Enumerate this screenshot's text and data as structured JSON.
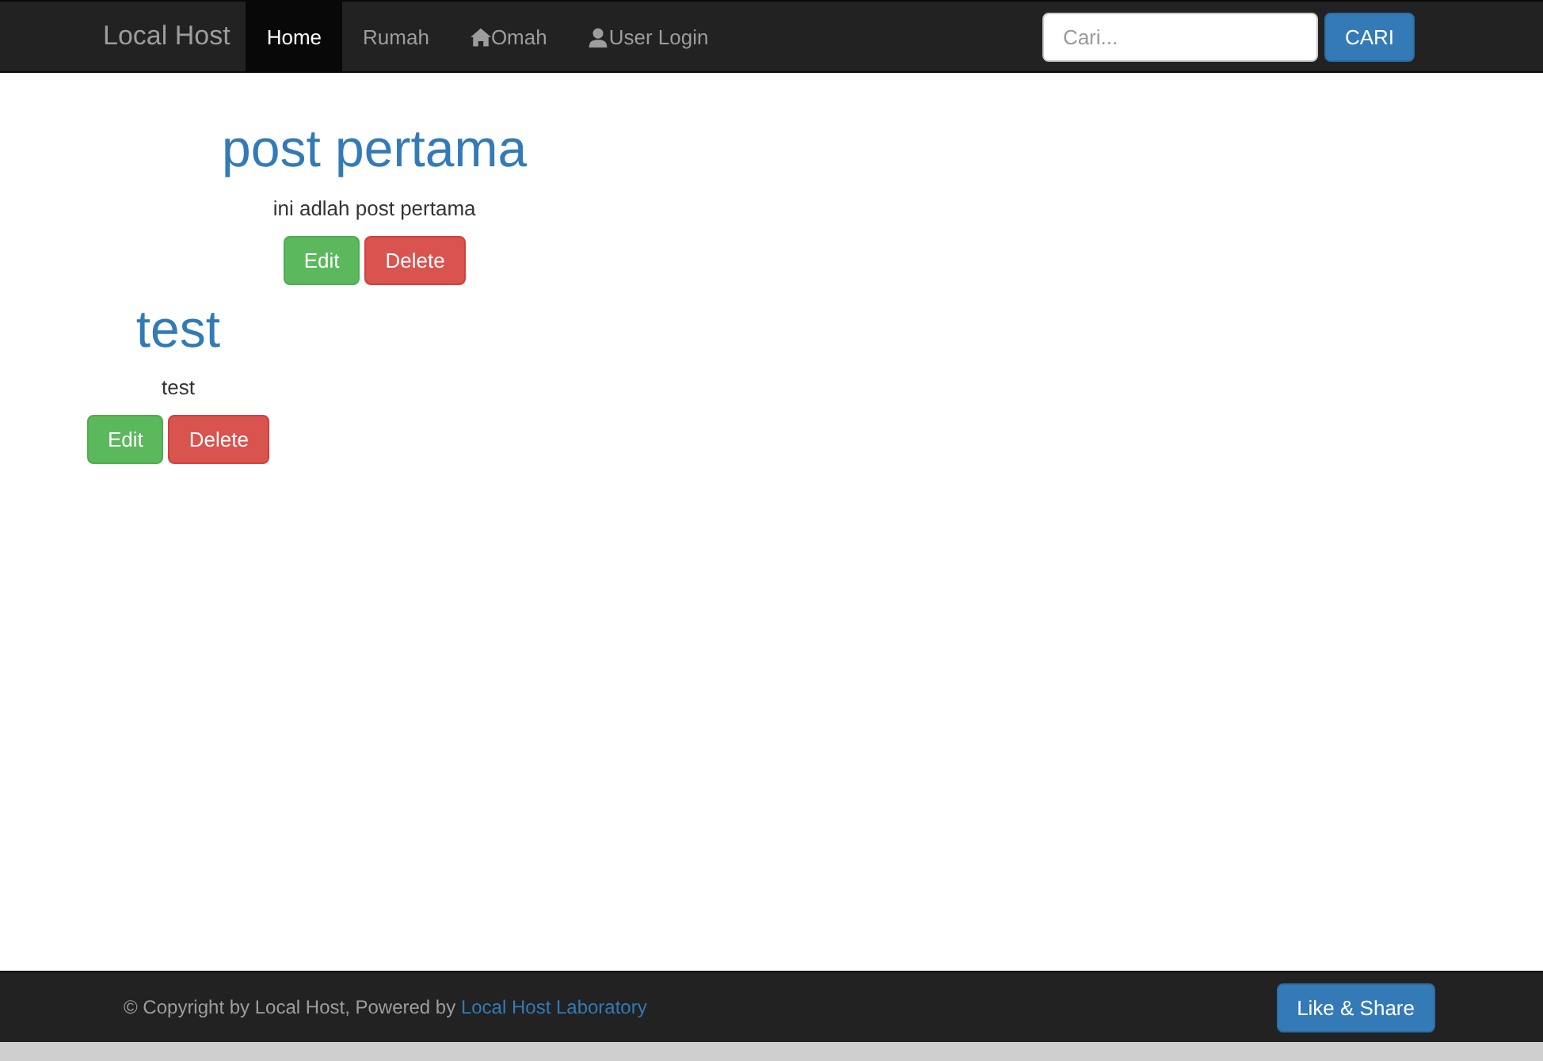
{
  "navbar": {
    "brand": "Local Host",
    "items": [
      {
        "label": "Home",
        "kind": "plain",
        "selected": true
      },
      {
        "label": "Rumah",
        "kind": "plain",
        "selected": false
      },
      {
        "label": "Omah",
        "kind": "home",
        "selected": false
      },
      {
        "label": "User Login",
        "kind": "user",
        "selected": false
      }
    ],
    "search": {
      "placeholder": "Cari...",
      "button": "CARI"
    }
  },
  "posts": [
    {
      "title": "post pertama",
      "body": "ini adlah post pertama",
      "buttons": [
        {
          "label": "Edit",
          "kind": "edit"
        },
        {
          "label": "Delete",
          "kind": "delete"
        }
      ]
    },
    {
      "title": "test",
      "body": "test",
      "buttons": [
        {
          "label": "Edit",
          "kind": "edit"
        },
        {
          "label": "Delete",
          "kind": "delete"
        }
      ]
    }
  ],
  "footer": {
    "text": "© Copyright by Local Host, Powered by ",
    "link": "Local Host Laboratory",
    "button": "Like & Share"
  }
}
